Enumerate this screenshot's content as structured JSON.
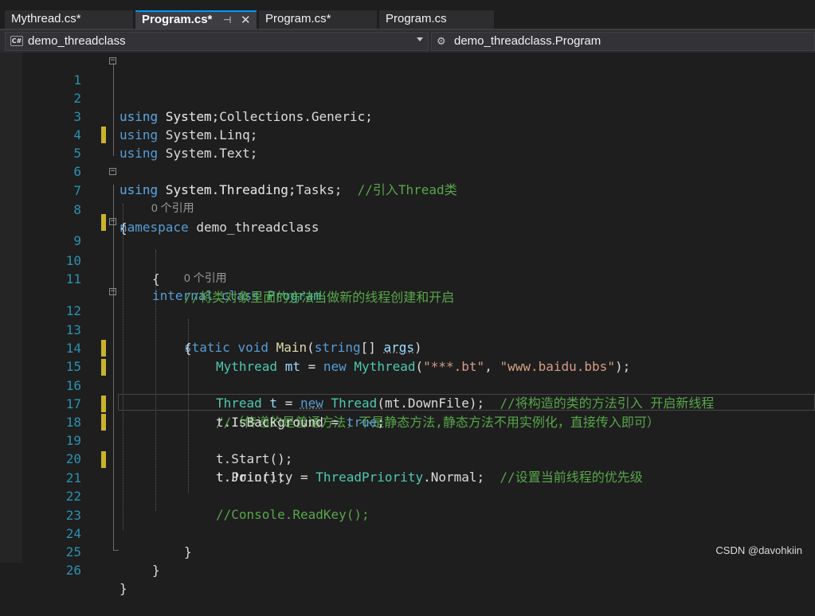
{
  "tabs": [
    {
      "label": "Mythread.cs*",
      "active": false
    },
    {
      "label": "Program.cs*",
      "active": true
    },
    {
      "label": "Program.cs*",
      "active": false
    },
    {
      "label": "Program.cs",
      "active": false
    }
  ],
  "tab_icons": {
    "pin": "pin-icon",
    "close": "close-icon"
  },
  "navbar": {
    "project": "demo_threadclass",
    "project_icon": "C#",
    "type": "demo_threadclass.Program"
  },
  "code": {
    "line_numbers": [
      "1",
      "2",
      "3",
      "4",
      "5",
      "6",
      "7",
      "8",
      "9",
      "10",
      "11",
      "12",
      "13",
      "14",
      "15",
      "16",
      "17",
      "18",
      "19",
      "20",
      "21",
      "22",
      "23",
      "24",
      "25",
      "26"
    ],
    "refs": {
      "class_ref": "0 个引用",
      "method_ref": "0 个引用"
    },
    "l1": {
      "kw": "using",
      "rest": " System;"
    },
    "l2": {
      "kw": "using",
      "rest": " System.Collections.Generic;"
    },
    "l3": {
      "kw": "using",
      "rest": " System.Linq;"
    },
    "l4": {
      "kw": "using",
      "rest": " System.Text;"
    },
    "l5": {
      "kw": "using",
      "rest": " System.Threading.Tasks;  ",
      "comment": "//引入Thread类"
    },
    "l6": {
      "kw": "using",
      "rest": " System.Threading;"
    },
    "l7": {
      "kw": "namespace",
      "rest": " demo_threadclass"
    },
    "l8": {
      "brace": "{"
    },
    "l9": {
      "kw1": "internal",
      "kw2": "class",
      "type": "Program"
    },
    "l10": {
      "brace": "{"
    },
    "l11": {
      "comment": "//将类对象里面的方法当做新的线程创建和开启"
    },
    "l12": {
      "kw1": "static",
      "kw2": "void",
      "method": "Main",
      "open": "(",
      "kw3": "string",
      "mid": "[] ",
      "param": "args",
      "close": ")"
    },
    "l13": {
      "brace": "{"
    },
    "l14": {
      "type1": "Mythread",
      "var": " mt",
      "eq": " = ",
      "kw": "new",
      "type2": " Mythread",
      "open": "(",
      "s1": "\"***.bt\"",
      "comma": ", ",
      "s2": "\"www.baidu.bbs\"",
      "close": ");"
    },
    "l15": {
      "type1": "Thread",
      "var": " t",
      "eq": " = ",
      "kw": "new",
      "type2": " Thread",
      "open": "(",
      "arg": "mt.DownFile",
      "close": ");  ",
      "comment": "//将构造的类的方法引入 开启新线程"
    },
    "l16": {
      "comment": "//（传递的是普通方法，不是静态方法,静态方法不用实例化，直接传入即可）"
    },
    "l17": {
      "a": "t.IsBackground = ",
      "kw": "true",
      "b": ";"
    },
    "l18": {
      "a": "t.",
      "method": "Start",
      "b": "();"
    },
    "l19": {
      "a": "t.Priority = ",
      "type": "ThreadPriority",
      "b": ".Normal;  ",
      "comment": "//设置当前线程的优先级"
    },
    "l20": {
      "a": "t.",
      "method": "Join",
      "b": "();"
    },
    "l22": {
      "comment": "//Console.ReadKey();"
    },
    "l24": {
      "brace": "}"
    },
    "l25": {
      "brace": "}"
    },
    "l26": {
      "brace": "}"
    }
  },
  "watermark": "CSDN @davohkiin",
  "colors": {
    "keyword": "#569cd6",
    "type": "#4ec9b0",
    "comment": "#57a64a",
    "string": "#d69d85",
    "line_number": "#2b91af",
    "change_marker": "#c8b42b",
    "active_tab_accent": "#0097fb"
  }
}
